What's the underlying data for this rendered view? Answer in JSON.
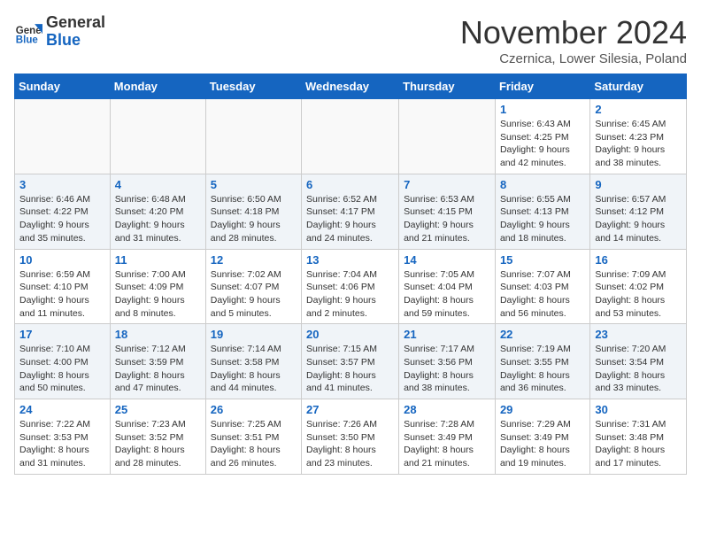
{
  "logo": {
    "general": "General",
    "blue": "Blue"
  },
  "header": {
    "month": "November 2024",
    "location": "Czernica, Lower Silesia, Poland"
  },
  "weekdays": [
    "Sunday",
    "Monday",
    "Tuesday",
    "Wednesday",
    "Thursday",
    "Friday",
    "Saturday"
  ],
  "weeks": [
    [
      null,
      null,
      null,
      null,
      null,
      {
        "day": 1,
        "sunrise": "6:43 AM",
        "sunset": "4:25 PM",
        "daylight": "9 hours and 42 minutes."
      },
      {
        "day": 2,
        "sunrise": "6:45 AM",
        "sunset": "4:23 PM",
        "daylight": "9 hours and 38 minutes."
      }
    ],
    [
      {
        "day": 3,
        "sunrise": "6:46 AM",
        "sunset": "4:22 PM",
        "daylight": "9 hours and 35 minutes."
      },
      {
        "day": 4,
        "sunrise": "6:48 AM",
        "sunset": "4:20 PM",
        "daylight": "9 hours and 31 minutes."
      },
      {
        "day": 5,
        "sunrise": "6:50 AM",
        "sunset": "4:18 PM",
        "daylight": "9 hours and 28 minutes."
      },
      {
        "day": 6,
        "sunrise": "6:52 AM",
        "sunset": "4:17 PM",
        "daylight": "9 hours and 24 minutes."
      },
      {
        "day": 7,
        "sunrise": "6:53 AM",
        "sunset": "4:15 PM",
        "daylight": "9 hours and 21 minutes."
      },
      {
        "day": 8,
        "sunrise": "6:55 AM",
        "sunset": "4:13 PM",
        "daylight": "9 hours and 18 minutes."
      },
      {
        "day": 9,
        "sunrise": "6:57 AM",
        "sunset": "4:12 PM",
        "daylight": "9 hours and 14 minutes."
      }
    ],
    [
      {
        "day": 10,
        "sunrise": "6:59 AM",
        "sunset": "4:10 PM",
        "daylight": "9 hours and 11 minutes."
      },
      {
        "day": 11,
        "sunrise": "7:00 AM",
        "sunset": "4:09 PM",
        "daylight": "9 hours and 8 minutes."
      },
      {
        "day": 12,
        "sunrise": "7:02 AM",
        "sunset": "4:07 PM",
        "daylight": "9 hours and 5 minutes."
      },
      {
        "day": 13,
        "sunrise": "7:04 AM",
        "sunset": "4:06 PM",
        "daylight": "9 hours and 2 minutes."
      },
      {
        "day": 14,
        "sunrise": "7:05 AM",
        "sunset": "4:04 PM",
        "daylight": "8 hours and 59 minutes."
      },
      {
        "day": 15,
        "sunrise": "7:07 AM",
        "sunset": "4:03 PM",
        "daylight": "8 hours and 56 minutes."
      },
      {
        "day": 16,
        "sunrise": "7:09 AM",
        "sunset": "4:02 PM",
        "daylight": "8 hours and 53 minutes."
      }
    ],
    [
      {
        "day": 17,
        "sunrise": "7:10 AM",
        "sunset": "4:00 PM",
        "daylight": "8 hours and 50 minutes."
      },
      {
        "day": 18,
        "sunrise": "7:12 AM",
        "sunset": "3:59 PM",
        "daylight": "8 hours and 47 minutes."
      },
      {
        "day": 19,
        "sunrise": "7:14 AM",
        "sunset": "3:58 PM",
        "daylight": "8 hours and 44 minutes."
      },
      {
        "day": 20,
        "sunrise": "7:15 AM",
        "sunset": "3:57 PM",
        "daylight": "8 hours and 41 minutes."
      },
      {
        "day": 21,
        "sunrise": "7:17 AM",
        "sunset": "3:56 PM",
        "daylight": "8 hours and 38 minutes."
      },
      {
        "day": 22,
        "sunrise": "7:19 AM",
        "sunset": "3:55 PM",
        "daylight": "8 hours and 36 minutes."
      },
      {
        "day": 23,
        "sunrise": "7:20 AM",
        "sunset": "3:54 PM",
        "daylight": "8 hours and 33 minutes."
      }
    ],
    [
      {
        "day": 24,
        "sunrise": "7:22 AM",
        "sunset": "3:53 PM",
        "daylight": "8 hours and 31 minutes."
      },
      {
        "day": 25,
        "sunrise": "7:23 AM",
        "sunset": "3:52 PM",
        "daylight": "8 hours and 28 minutes."
      },
      {
        "day": 26,
        "sunrise": "7:25 AM",
        "sunset": "3:51 PM",
        "daylight": "8 hours and 26 minutes."
      },
      {
        "day": 27,
        "sunrise": "7:26 AM",
        "sunset": "3:50 PM",
        "daylight": "8 hours and 23 minutes."
      },
      {
        "day": 28,
        "sunrise": "7:28 AM",
        "sunset": "3:49 PM",
        "daylight": "8 hours and 21 minutes."
      },
      {
        "day": 29,
        "sunrise": "7:29 AM",
        "sunset": "3:49 PM",
        "daylight": "8 hours and 19 minutes."
      },
      {
        "day": 30,
        "sunrise": "7:31 AM",
        "sunset": "3:48 PM",
        "daylight": "8 hours and 17 minutes."
      }
    ]
  ]
}
